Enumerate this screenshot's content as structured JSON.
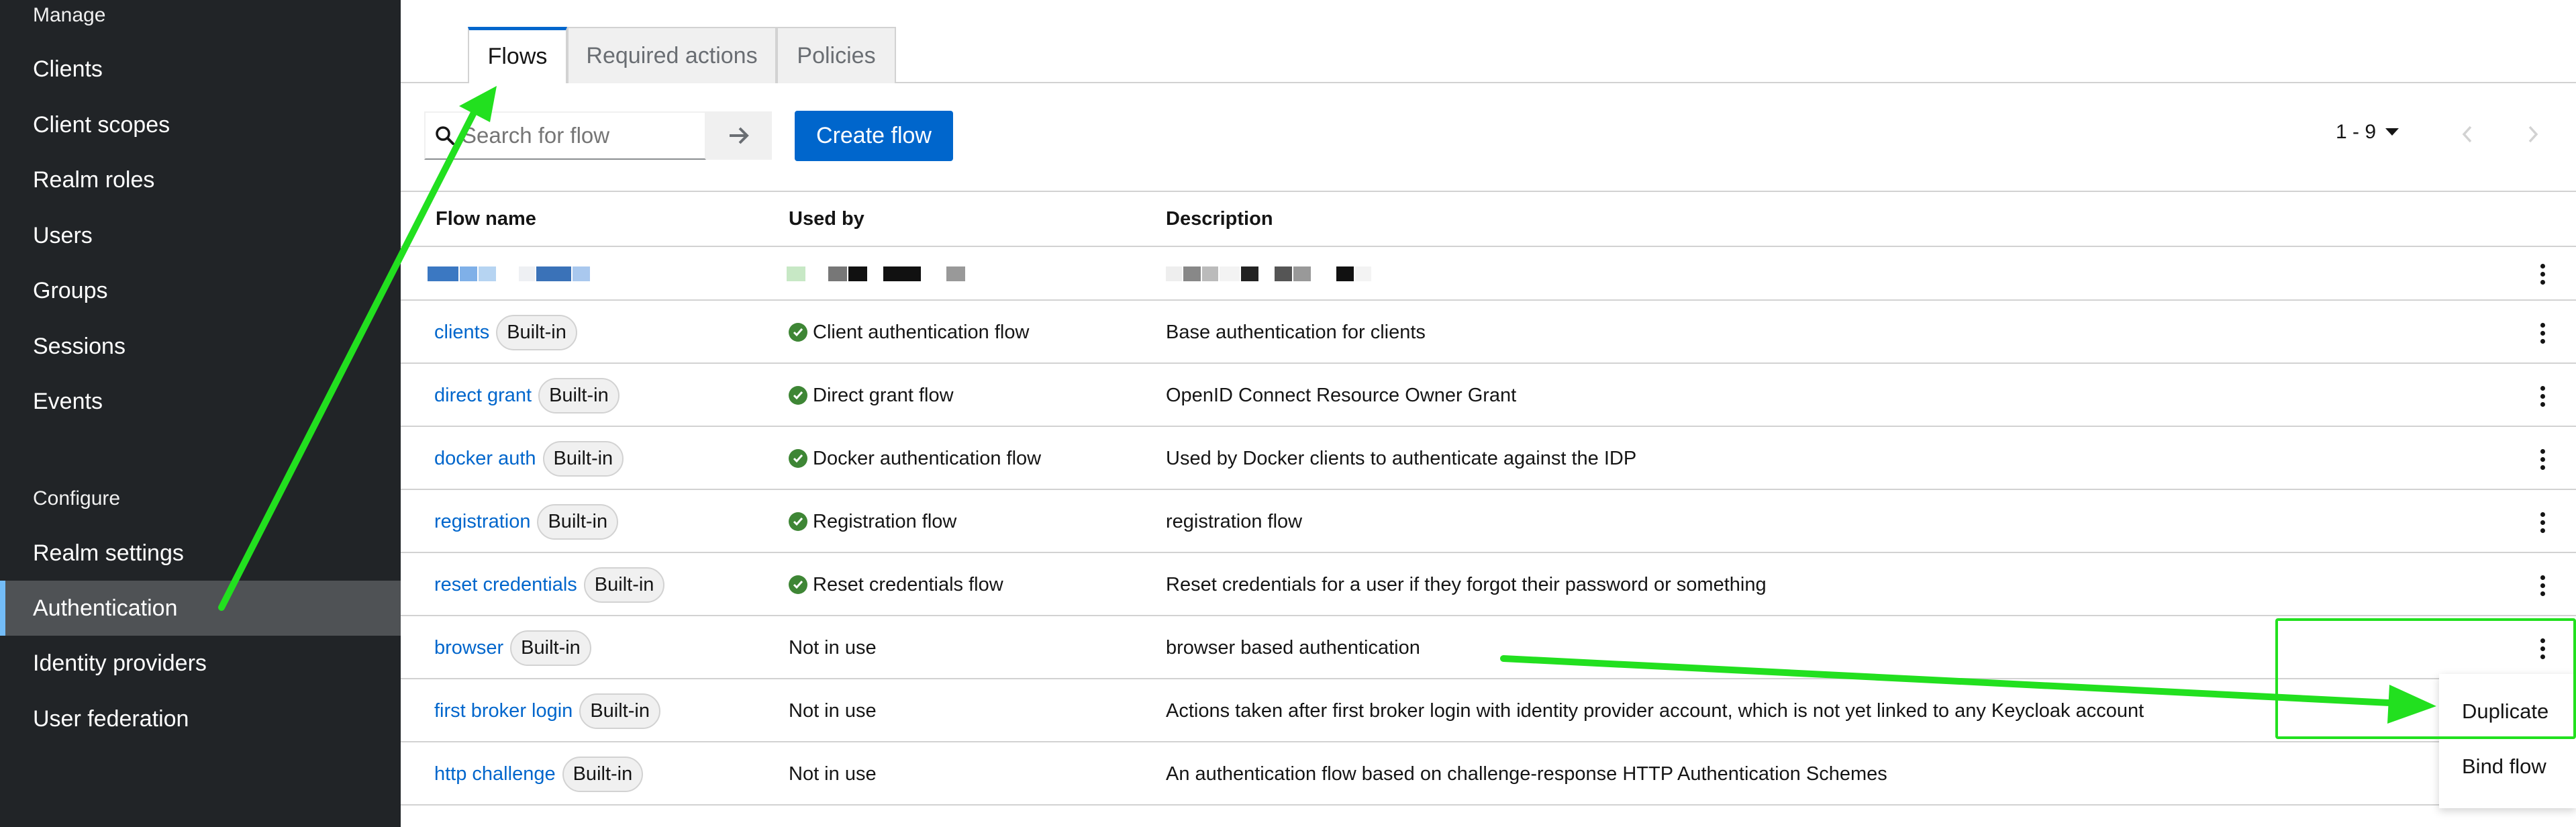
{
  "sidebar": {
    "manage_label": "Manage",
    "manage_items": [
      {
        "label": "Clients"
      },
      {
        "label": "Client scopes"
      },
      {
        "label": "Realm roles"
      },
      {
        "label": "Users"
      },
      {
        "label": "Groups"
      },
      {
        "label": "Sessions"
      },
      {
        "label": "Events"
      }
    ],
    "configure_label": "Configure",
    "configure_items": [
      {
        "label": "Realm settings"
      },
      {
        "label": "Authentication",
        "active": true
      },
      {
        "label": "Identity providers"
      },
      {
        "label": "User federation"
      }
    ]
  },
  "tabs": [
    {
      "label": "Flows",
      "active": true
    },
    {
      "label": "Required actions"
    },
    {
      "label": "Policies"
    }
  ],
  "toolbar": {
    "search_placeholder": "Search for flow",
    "create_label": "Create flow",
    "pagination": "1 - 9"
  },
  "table": {
    "headers": {
      "name": "Flow name",
      "used_by": "Used by",
      "description": "Description"
    },
    "rows": [
      {
        "name": "clients",
        "badge": "Built-in",
        "used_by": "Client authentication flow",
        "in_use": true,
        "description": "Base authentication for clients"
      },
      {
        "name": "direct grant",
        "badge": "Built-in",
        "used_by": "Direct grant flow",
        "in_use": true,
        "description": "OpenID Connect Resource Owner Grant"
      },
      {
        "name": "docker auth",
        "badge": "Built-in",
        "used_by": "Docker authentication flow",
        "in_use": true,
        "description": "Used by Docker clients to authenticate against the IDP"
      },
      {
        "name": "registration",
        "badge": "Built-in",
        "used_by": "Registration flow",
        "in_use": true,
        "description": "registration flow"
      },
      {
        "name": "reset credentials",
        "badge": "Built-in",
        "used_by": "Reset credentials flow",
        "in_use": true,
        "description": "Reset credentials for a user if they forgot their password or something"
      },
      {
        "name": "browser",
        "badge": "Built-in",
        "used_by": "Not in use",
        "in_use": false,
        "description": "browser based authentication"
      },
      {
        "name": "first broker login",
        "badge": "Built-in",
        "used_by": "Not in use",
        "in_use": false,
        "description": "Actions taken after first broker login with identity provider account, which is not yet linked to any Keycloak account"
      },
      {
        "name": "http challenge",
        "badge": "Built-in",
        "used_by": "Not in use",
        "in_use": false,
        "description": "An authentication flow based on challenge-response HTTP Authentication Schemes"
      }
    ]
  },
  "dropdown": {
    "items": [
      {
        "label": "Duplicate"
      },
      {
        "label": "Bind flow"
      }
    ]
  },
  "colors": {
    "accent": "#0066cc",
    "sidebar_bg": "#212427",
    "success": "#3e8635",
    "annotation": "#22e01f"
  }
}
